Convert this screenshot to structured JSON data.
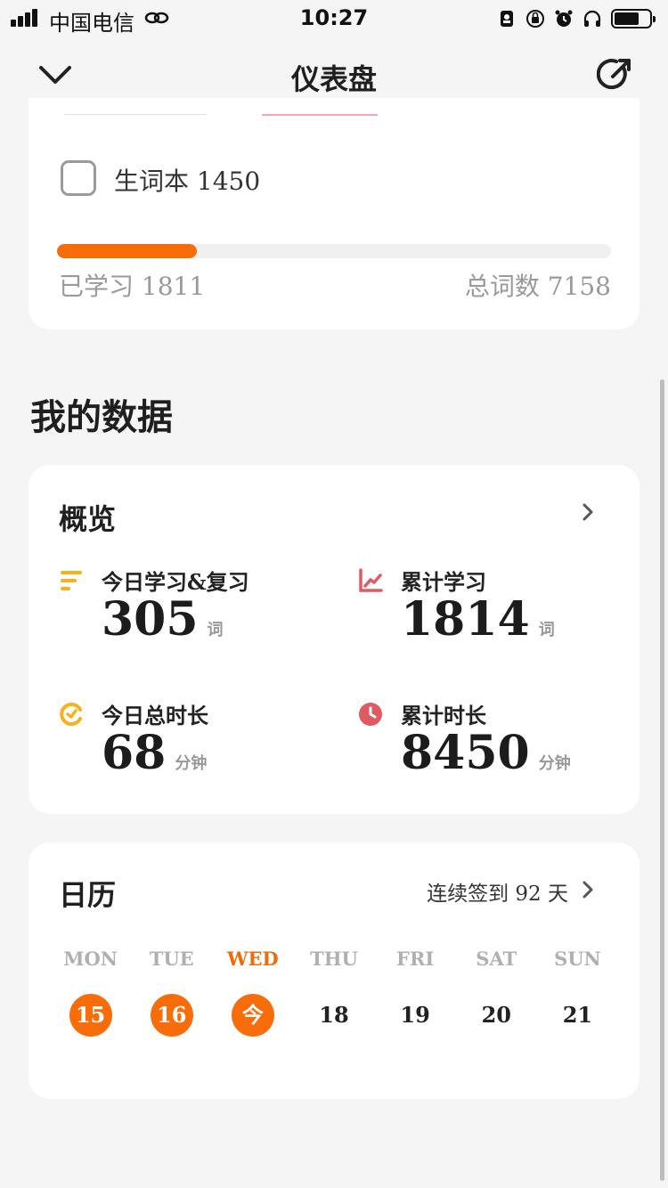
{
  "status": {
    "carrier": "中国电信",
    "time": "10:27"
  },
  "nav": {
    "title": "仪表盘"
  },
  "top_card": {
    "wordbook_label": "生词本 1450",
    "learned": "已学习 1811",
    "total": "总词数 7158",
    "progress_fraction": 0.253,
    "accent": "#f86d0a"
  },
  "section_title": "我的数据",
  "overview": {
    "title": "概览",
    "stats": [
      {
        "label": "今日学习&复习",
        "value": "305",
        "unit": "词",
        "icon": "lines-icon",
        "color": "#f5b21c"
      },
      {
        "label": "累计学习",
        "value": "1814",
        "unit": "词",
        "icon": "line-chart-icon",
        "color": "#e05a62"
      },
      {
        "label": "今日总时长",
        "value": "68",
        "unit": "分钟",
        "icon": "timer-icon",
        "color": "#f5b21c"
      },
      {
        "label": "累计时长",
        "value": "8450",
        "unit": "分钟",
        "icon": "clock-icon",
        "color": "#e05a62"
      }
    ]
  },
  "calendar": {
    "title": "日历",
    "streak": "连续签到 92 天",
    "weekdays": [
      "MON",
      "TUE",
      "WED",
      "THU",
      "FRI",
      "SAT",
      "SUN"
    ],
    "days": [
      "15",
      "16",
      "今",
      "18",
      "19",
      "20",
      "21"
    ],
    "today_index": 2
  }
}
